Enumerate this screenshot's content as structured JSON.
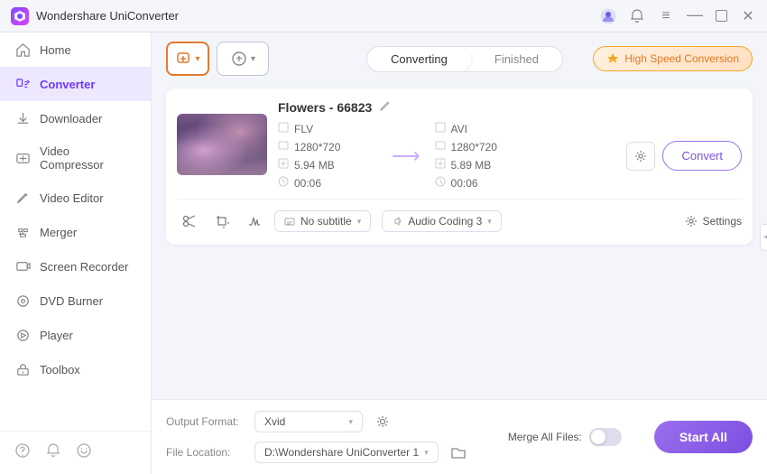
{
  "titleBar": {
    "appName": "Wondershare UniConverter",
    "userIcon": "user-avatar-icon",
    "bellIcon": "bell-icon",
    "menuIcon": "menu-icon",
    "minimizeIcon": "minimize-icon",
    "maximizeIcon": "maximize-icon",
    "closeIcon": "close-icon"
  },
  "sidebar": {
    "items": [
      {
        "id": "home",
        "label": "Home",
        "icon": "home-icon"
      },
      {
        "id": "converter",
        "label": "Converter",
        "icon": "converter-icon",
        "active": true
      },
      {
        "id": "downloader",
        "label": "Downloader",
        "icon": "downloader-icon"
      },
      {
        "id": "video-compressor",
        "label": "Video Compressor",
        "icon": "compress-icon"
      },
      {
        "id": "video-editor",
        "label": "Video Editor",
        "icon": "edit-icon"
      },
      {
        "id": "merger",
        "label": "Merger",
        "icon": "merger-icon"
      },
      {
        "id": "screen-recorder",
        "label": "Screen Recorder",
        "icon": "record-icon"
      },
      {
        "id": "dvd-burner",
        "label": "DVD Burner",
        "icon": "dvd-icon"
      },
      {
        "id": "player",
        "label": "Player",
        "icon": "player-icon"
      },
      {
        "id": "toolbox",
        "label": "Toolbox",
        "icon": "toolbox-icon"
      }
    ],
    "bottomIcons": [
      "help-icon",
      "notification-icon",
      "feedback-icon"
    ]
  },
  "toolbar": {
    "addBtnLabel": "+",
    "formatBtnLabel": "⊕",
    "tabs": [
      {
        "id": "converting",
        "label": "Converting",
        "active": true
      },
      {
        "id": "finished",
        "label": "Finished",
        "active": false
      }
    ],
    "highSpeedLabel": "High Speed Conversion"
  },
  "fileCard": {
    "title": "Flowers - 66823",
    "editIcon": "edit-pencil-icon",
    "source": {
      "format": "FLV",
      "resolution": "1280*720",
      "fileSize": "5.94 MB",
      "duration": "00:06"
    },
    "target": {
      "format": "AVI",
      "resolution": "1280*720",
      "fileSize": "5.89 MB",
      "duration": "00:06"
    },
    "bottomActions": {
      "cutIcon": "scissors-icon",
      "cropIcon": "crop-icon",
      "effectsIcon": "effects-icon",
      "subtitleLabel": "No subtitle",
      "audioLabel": "Audio Coding 3",
      "settingsLabel": "Settings"
    },
    "convertBtnLabel": "Convert"
  },
  "footer": {
    "outputFormatLabel": "Output Format:",
    "outputFormatValue": "Xvid",
    "fileLocationLabel": "File Location:",
    "fileLocationValue": "D:\\Wondershare UniConverter 1",
    "mergeAllLabel": "Merge All Files:",
    "startAllLabel": "Start All"
  }
}
